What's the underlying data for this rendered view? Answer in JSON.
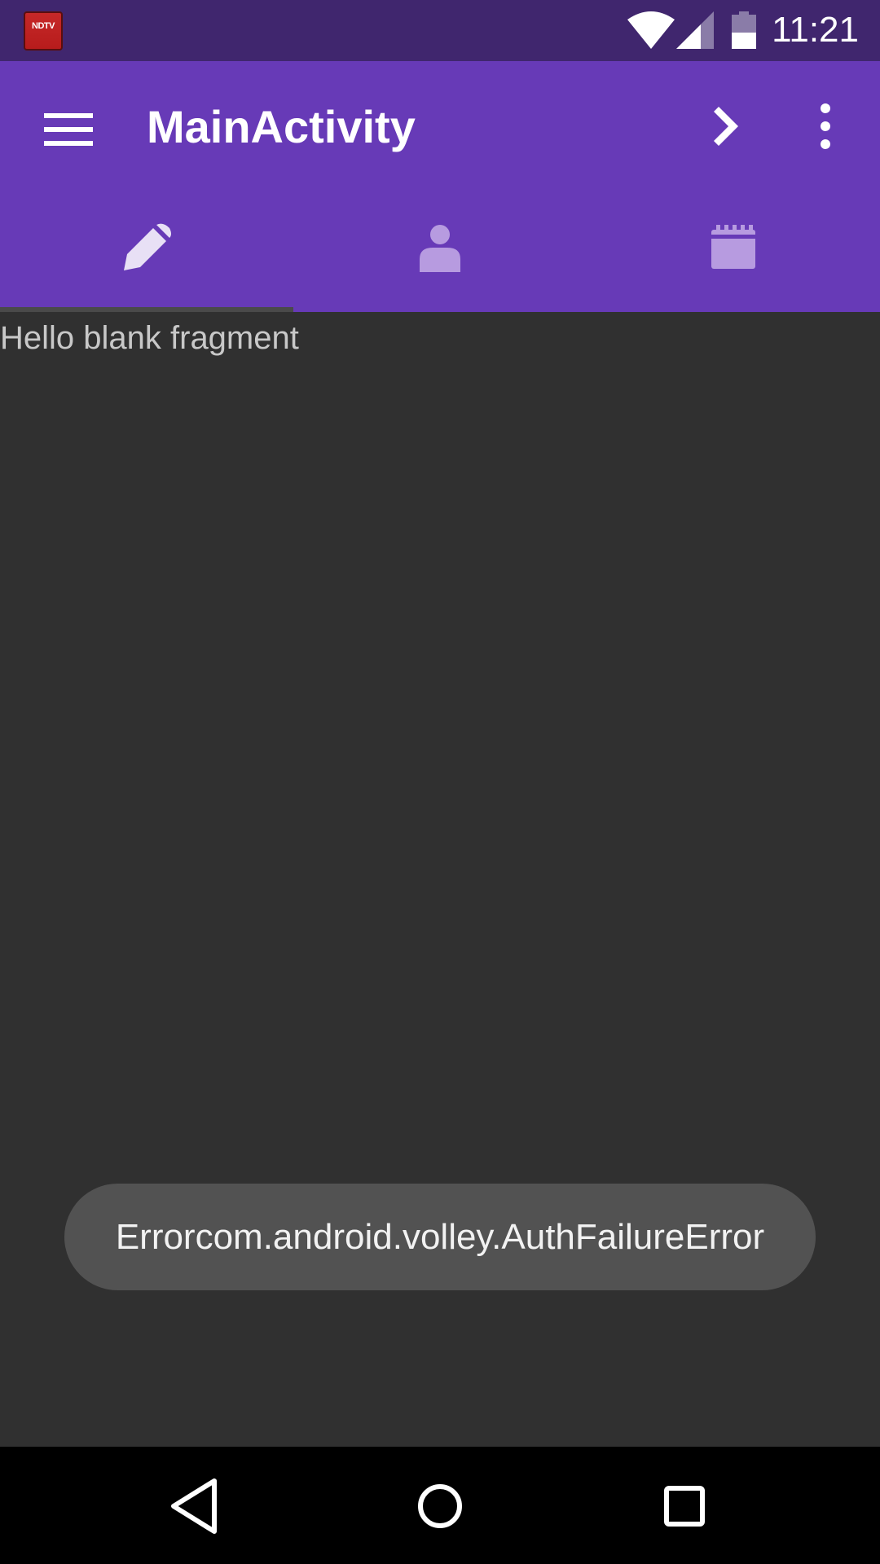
{
  "status_bar": {
    "notification_app": "NDTV",
    "time": "11:21",
    "icons": [
      "wifi-icon",
      "cell-signal-icon",
      "battery-icon"
    ]
  },
  "app_bar": {
    "title": "MainActivity",
    "menu_icon": "hamburger-menu-icon",
    "action_icon": "chevron-right-icon",
    "overflow_icon": "more-vert-icon",
    "color": "#673ab7"
  },
  "tabs": [
    {
      "icon": "pencil-icon",
      "selected": true
    },
    {
      "icon": "person-icon",
      "selected": false
    },
    {
      "icon": "calendar-icon",
      "selected": false
    }
  ],
  "content": {
    "text": "Hello blank fragment"
  },
  "toast": {
    "message": "Errorcom.android.volley.AuthFailureError"
  },
  "nav_bar": {
    "icons": [
      "back-icon",
      "home-icon",
      "recents-icon"
    ]
  }
}
